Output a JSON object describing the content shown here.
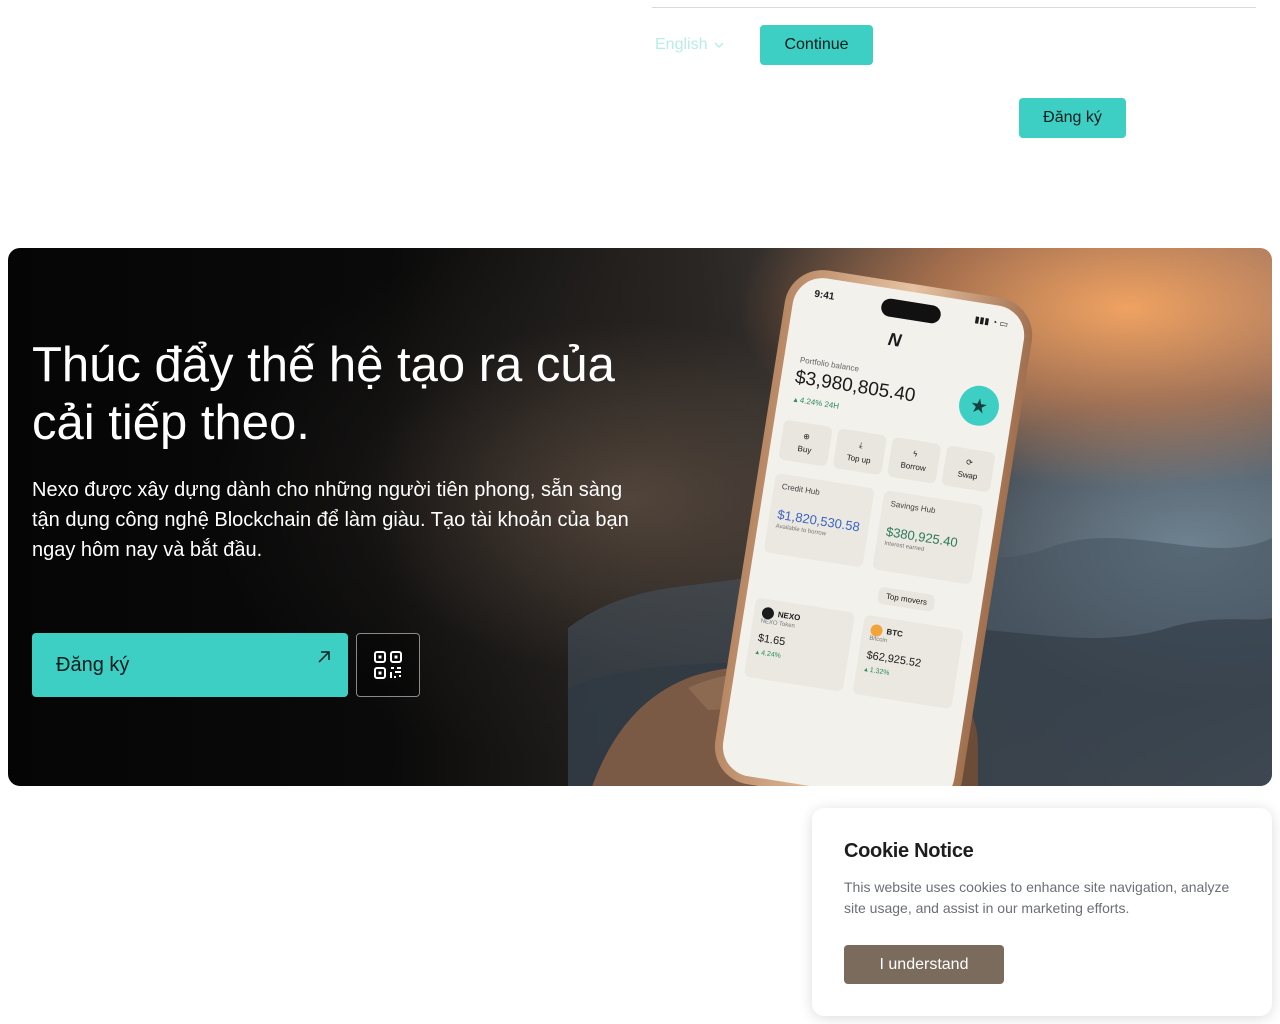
{
  "header": {
    "language": "English",
    "continue_label": "Continue",
    "signup_label": "Đăng ký"
  },
  "hero": {
    "title": "Thúc đẩy thế hệ tạo ra của cải tiếp theo.",
    "description": "Nexo được xây dựng dành cho những người tiên phong, sẵn sàng tận dụng công nghệ Blockchain để làm giàu. Tạo tài khoản của bạn ngay hôm nay và bắt đầu.",
    "signup_label": "Đăng ký",
    "phone": {
      "time": "9:41",
      "portfolio_label": "Portfolio balance",
      "balance": "$3,980,805.40",
      "change": "▴ 4.24% 24H",
      "actions": [
        "Buy",
        "Top up",
        "Borrow",
        "Swap"
      ],
      "credit_hub": {
        "title": "Credit Hub",
        "value": "$1,820,530.58",
        "sub": "Available to borrow"
      },
      "savings_hub": {
        "title": "Savings Hub",
        "value": "$380,925.40",
        "sub": "Interest earned"
      },
      "top_movers": "Top movers",
      "coins": [
        {
          "symbol": "NEXO",
          "name": "NEXO Token",
          "price": "$1.65",
          "change": "▴ 4.24%"
        },
        {
          "symbol": "BTC",
          "name": "Bitcoin",
          "price": "$62,925.52",
          "change": "▴ 1.32%"
        }
      ]
    }
  },
  "cookie": {
    "title": "Cookie Notice",
    "text": "This website uses cookies to enhance site navigation, analyze site usage, and assist in our marketing efforts.",
    "button_label": "I understand"
  },
  "colors": {
    "accent": "#3ecfc4",
    "cookie_button": "#7a6b5c"
  }
}
